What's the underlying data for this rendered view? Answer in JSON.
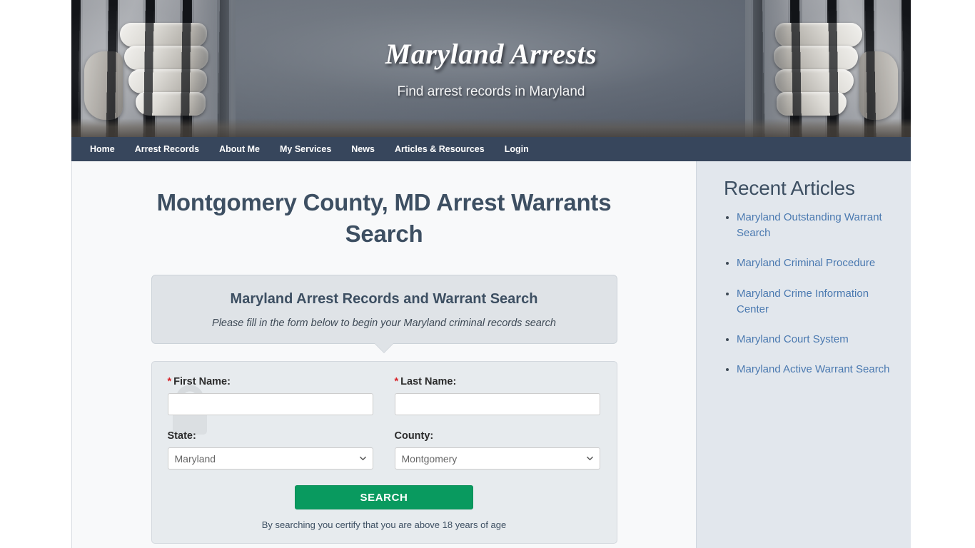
{
  "header": {
    "site_title": "Maryland Arrests",
    "tagline": "Find arrest records in Maryland"
  },
  "nav": {
    "items": [
      {
        "label": "Home"
      },
      {
        "label": "Arrest Records"
      },
      {
        "label": "About Me"
      },
      {
        "label": "My Services"
      },
      {
        "label": "News"
      },
      {
        "label": "Articles & Resources"
      },
      {
        "label": "Login"
      }
    ]
  },
  "main": {
    "page_title": "Montgomery County, MD Arrest Warrants Search",
    "callout": {
      "heading": "Maryland Arrest Records and Warrant Search",
      "subtext": "Please fill in the form below to begin your Maryland criminal records search"
    },
    "form": {
      "first_name": {
        "label": "First Name:",
        "required_marker": "*",
        "value": "",
        "placeholder": ""
      },
      "last_name": {
        "label": "Last Name:",
        "required_marker": "*",
        "value": "",
        "placeholder": ""
      },
      "state": {
        "label": "State:",
        "selected": "Maryland",
        "options": [
          "Maryland"
        ]
      },
      "county": {
        "label": "County:",
        "selected": "Montgomery",
        "options": [
          "Montgomery"
        ]
      },
      "submit_label": "SEARCH",
      "certify_text": "By searching you certify that you are above 18 years of age"
    }
  },
  "sidebar": {
    "heading": "Recent Articles",
    "articles": [
      {
        "label": "Maryland Outstanding Warrant Search"
      },
      {
        "label": "Maryland Criminal Procedure"
      },
      {
        "label": "Maryland Crime Information Center"
      },
      {
        "label": "Maryland Court System"
      },
      {
        "label": "Maryland Active Warrant Search"
      }
    ]
  },
  "colors": {
    "nav_background": "#283850",
    "heading_text": "#3d4f62",
    "link": "#4a79b0",
    "search_button": "#099a5f",
    "required_asterisk": "#d8262c",
    "sidebar_background": "#e2e7ed"
  }
}
